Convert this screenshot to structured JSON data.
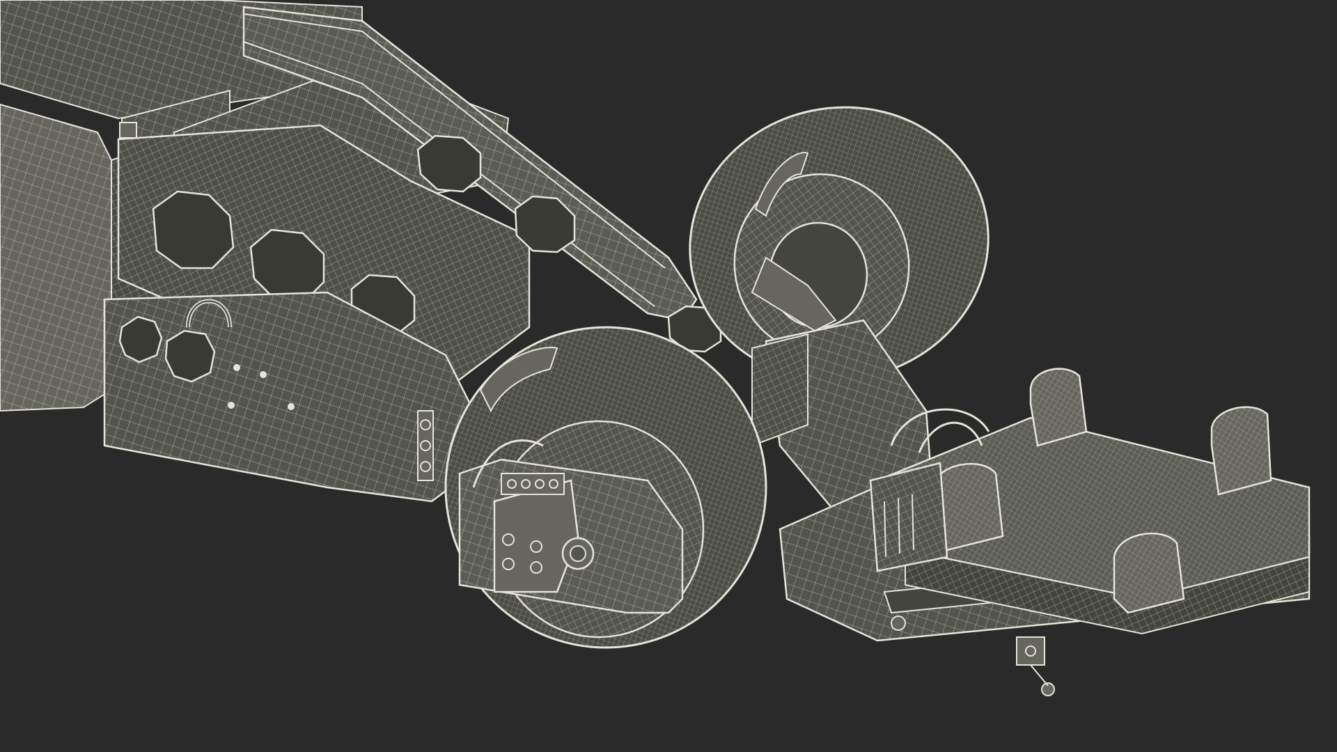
{
  "scene": {
    "subject_icon": "wireframe-chassis-icon",
    "background_color": "#2a2a2a",
    "surface_color": "#55554f",
    "surface_light_color": "#66665f",
    "surface_dark_color": "#45453f",
    "wire_color": "#e6e4da",
    "tire_color": "#4c4c46",
    "hole_color": "#3a3a35"
  }
}
